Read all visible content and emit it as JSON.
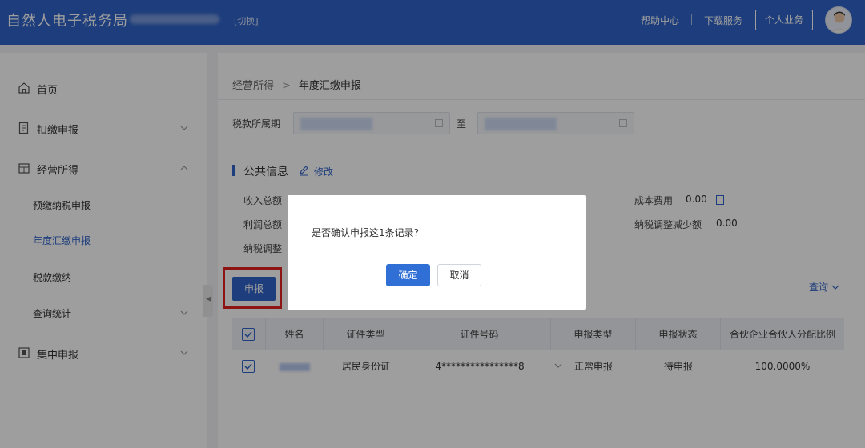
{
  "header": {
    "app_title": "自然人电子税务局",
    "switch_label": "[切换]",
    "help_label": "帮助中心",
    "download_label": "下载服务",
    "personal_label": "个人业务"
  },
  "sidebar": {
    "items": [
      {
        "label": "首页",
        "icon": "home-icon"
      },
      {
        "label": "扣缴申报",
        "icon": "deduction-icon"
      },
      {
        "label": "经营所得",
        "icon": "business-icon"
      },
      {
        "label": "预缴纳税申报"
      },
      {
        "label": "年度汇缴申报"
      },
      {
        "label": "税款缴纳"
      },
      {
        "label": "查询统计"
      },
      {
        "label": "集中申报",
        "icon": "batch-icon"
      }
    ]
  },
  "breadcrumb": {
    "parent": "经营所得",
    "separator": ">",
    "current": "年度汇缴申报"
  },
  "filter": {
    "period_label": "税款所属期",
    "to_label": "至"
  },
  "public_info": {
    "title": "公共信息",
    "edit_label": "修改",
    "income_total_label": "收入总额",
    "profit_total_label": "利润总额",
    "tax_adjust_label": "纳税调整",
    "cost_label": "成本费用",
    "cost_value": "0.00",
    "tax_decrease_label": "纳税调整减少额",
    "tax_decrease_value": "0.00"
  },
  "actions": {
    "declare_label": "申报",
    "query_label": "查询"
  },
  "table": {
    "headers": [
      "姓名",
      "证件类型",
      "证件号码",
      "申报类型",
      "申报状态",
      "合伙企业合伙人分配比例"
    ],
    "rows": [
      {
        "id_type": "居民身份证",
        "id_number": "4****************8",
        "declare_type": "正常申报",
        "status": "待申报",
        "ratio": "100.0000%"
      }
    ]
  },
  "modal": {
    "message": "是否确认申报这1条记录?",
    "confirm_label": "确定",
    "cancel_label": "取消"
  },
  "colors": {
    "brand": "#2f63c8",
    "highlight": "#e62020"
  }
}
